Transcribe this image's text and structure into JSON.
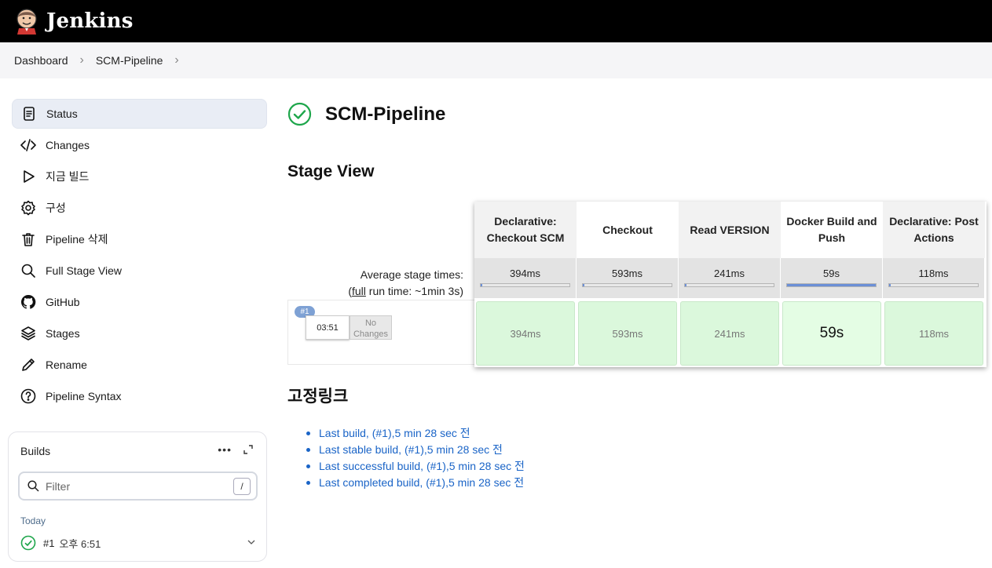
{
  "header": {
    "brand": "Jenkins",
    "logo_icon": "jenkins-butler-logo"
  },
  "breadcrumb": [
    "Dashboard",
    "SCM-Pipeline"
  ],
  "sidebar": {
    "items": [
      {
        "label": "Status",
        "icon": "status-icon",
        "active": true
      },
      {
        "label": "Changes",
        "icon": "code-icon"
      },
      {
        "label": "지금 빌드",
        "icon": "play-icon"
      },
      {
        "label": "구성",
        "icon": "gear-icon"
      },
      {
        "label": "Pipeline 삭제",
        "icon": "trash-icon"
      },
      {
        "label": "Full Stage View",
        "icon": "search-icon"
      },
      {
        "label": "GitHub",
        "icon": "github-icon"
      },
      {
        "label": "Stages",
        "icon": "layers-icon"
      },
      {
        "label": "Rename",
        "icon": "pencil-icon"
      },
      {
        "label": "Pipeline Syntax",
        "icon": "help-icon"
      }
    ]
  },
  "builds": {
    "title": "Builds",
    "more": "•••",
    "filter_placeholder": "Filter",
    "filter_shortcut": "/",
    "group": "Today",
    "rows": [
      {
        "number": "#1",
        "time": "오후 6:51",
        "status": "success"
      }
    ]
  },
  "main": {
    "title": "SCM-Pipeline",
    "status_color": "#1ea64b",
    "stage_view_heading": "Stage View",
    "avg_label_line1": "Average stage times:",
    "avg_label_full": "full",
    "avg_label_line2_rest": " run time: ~1min 3s)",
    "avg_label_paren": "(",
    "stages": [
      {
        "name": "Declarative: Checkout SCM",
        "avg": "394ms",
        "bar": 0.02,
        "run": "394ms"
      },
      {
        "name": "Checkout",
        "avg": "593ms",
        "bar": 0.02,
        "run": "593ms"
      },
      {
        "name": "Read VERSION",
        "avg": "241ms",
        "bar": 0.02,
        "run": "241ms"
      },
      {
        "name": "Docker Build and Push",
        "avg": "59s",
        "bar": 1.0,
        "run": "59s"
      },
      {
        "name": "Declarative: Post Actions",
        "avg": "118ms",
        "bar": 0.02,
        "run": "118ms"
      }
    ],
    "run": {
      "badge": "#1",
      "time": "03:51",
      "changes": "No Changes"
    },
    "permalinks_heading": "고정링크",
    "permalinks": [
      "Last build, (#1),5 min 28 sec 전",
      "Last stable build, (#1),5 min 28 sec 전",
      "Last successful build, (#1),5 min 28 sec 전",
      "Last completed build, (#1),5 min 28 sec 전"
    ]
  }
}
